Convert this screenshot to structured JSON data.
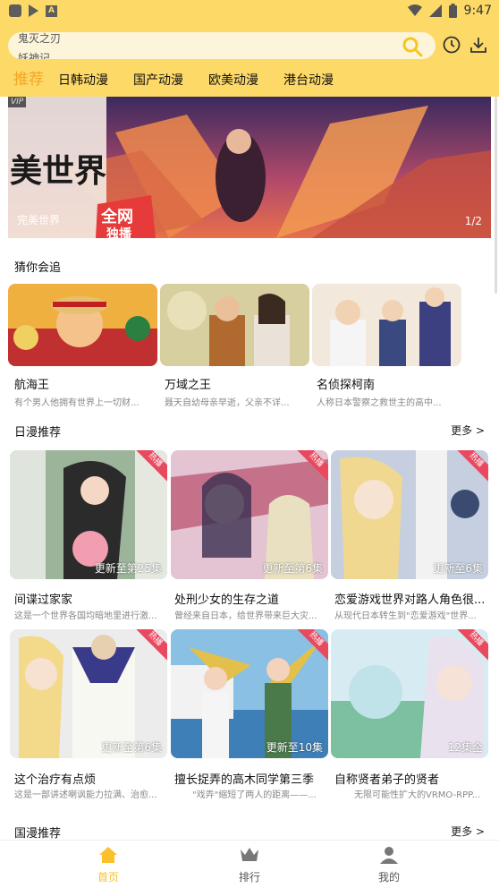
{
  "status_bar": {
    "time": "9:47",
    "a_glyph": "A"
  },
  "search": {
    "scroll_text_1": "鬼灭之刃",
    "scroll_text_2": "妖神记"
  },
  "tabs": [
    {
      "label": "推荐",
      "active": true
    },
    {
      "label": "日韩动漫"
    },
    {
      "label": "国产动漫"
    },
    {
      "label": "欧美动漫"
    },
    {
      "label": "港台动漫"
    }
  ],
  "banner": {
    "title": "完美世界",
    "page": "1/2",
    "vip": "VIP",
    "art_text": "美世界",
    "badge_line1": "全网",
    "badge_line2": "独播"
  },
  "guess": {
    "title": "猜你会追",
    "items": [
      {
        "name": "航海王",
        "desc": "有个男人他拥有世界上一切财..."
      },
      {
        "name": "万域之王",
        "desc": "聂天自幼母亲早逝，父亲不详..."
      },
      {
        "name": "名侦探柯南",
        "desc": "人称日本警察之救世主的高中..."
      }
    ]
  },
  "japan": {
    "title": "日漫推荐",
    "more": "更多 >",
    "hot": "热播",
    "items": [
      {
        "name": "间谍过家家",
        "desc": "这是一个世界各国均暗地里进行激...",
        "ep": "更新至第25集"
      },
      {
        "name": "处刑少女的生存之道",
        "desc": "曾经来自日本，给世界带来巨大灾...",
        "ep": "更新至第6集"
      },
      {
        "name": "恋爱游戏世界对路人角色很...",
        "desc": "从现代日本转生到\"恋爱游戏\"世界...",
        "ep": "更新至6集"
      },
      {
        "name": "这个治疗有点烦",
        "desc": "这是一部讲述喇讽能力拉满、治愈...",
        "ep": "更新至第6集"
      },
      {
        "name": "擅长捉弄的高木同学第三季",
        "desc": "\"戏弄\"缩短了两人的距离——...",
        "ep": "更新至10集"
      },
      {
        "name": "自称贤者弟子的贤者",
        "desc": "无限可能性扩大的VRMO-RPP...",
        "ep": "12集全"
      }
    ]
  },
  "china": {
    "title": "国漫推荐",
    "more": "更多 >"
  },
  "nav": [
    {
      "label": "首页",
      "active": true
    },
    {
      "label": "排行"
    },
    {
      "label": "我的"
    }
  ],
  "colors": {
    "header": "#fdd968",
    "accent": "#f5a623",
    "hot": "#e8495f",
    "nav_active": "#fbc02d"
  }
}
